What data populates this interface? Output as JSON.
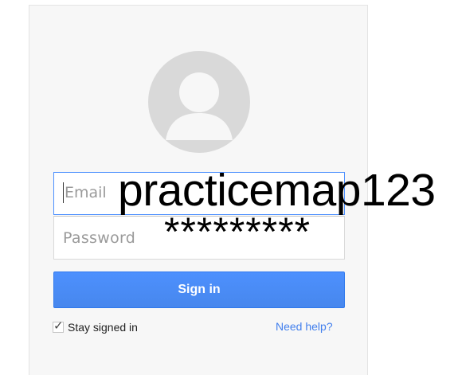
{
  "form": {
    "email_placeholder": "Email",
    "password_placeholder": "Password",
    "signin_label": "Sign in",
    "stay_signed_in_label": "Stay signed in",
    "stay_signed_in_checked": true,
    "need_help_label": "Need help?"
  },
  "overlay": {
    "username_text": "practicemap123",
    "password_text": "*********"
  },
  "icons": {
    "avatar": "user-avatar-icon",
    "checkbox": "checkmark-icon"
  },
  "colors": {
    "primary_button": "#4d90fe",
    "link": "#427fed",
    "focus_border": "#4d90fe"
  }
}
